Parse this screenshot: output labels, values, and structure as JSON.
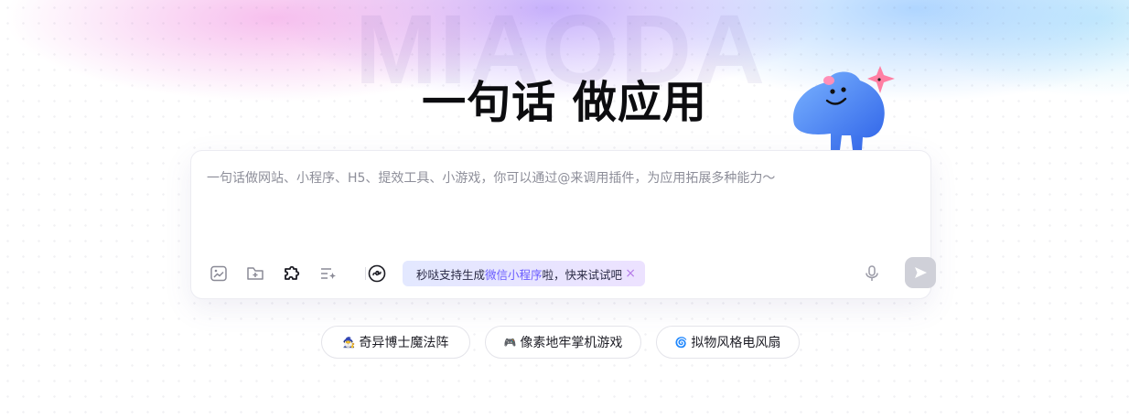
{
  "watermark": "MIAODA",
  "hero_title": "一句话 做应用",
  "input": {
    "placeholder": "一句话做网站、小程序、H5、提效工具、小游戏，你可以通过@来调用插件，为应用拓展多种能力～"
  },
  "promo": {
    "prefix": "秒哒支持生成 ",
    "highlight": "微信小程序",
    "suffix": " 啦，快来试试吧",
    "close_icon": "×"
  },
  "toolbar_icons": [
    "image-icon",
    "folder-upload-icon",
    "plugin-icon",
    "prompt-enhance-icon",
    "miniprogram-icon",
    "microphone-icon",
    "send-icon"
  ],
  "suggestions": [
    {
      "emoji": "🧙‍♂️",
      "label": "奇异博士魔法阵"
    },
    {
      "emoji": "🎮",
      "label": "像素地牢掌机游戏"
    },
    {
      "emoji": "🌀",
      "label": "拟物风格电风扇"
    }
  ],
  "colors": {
    "accent": "#6a5cff",
    "send_disabled": "#cfd0d8",
    "promo_bg": "#e6e4ff"
  }
}
